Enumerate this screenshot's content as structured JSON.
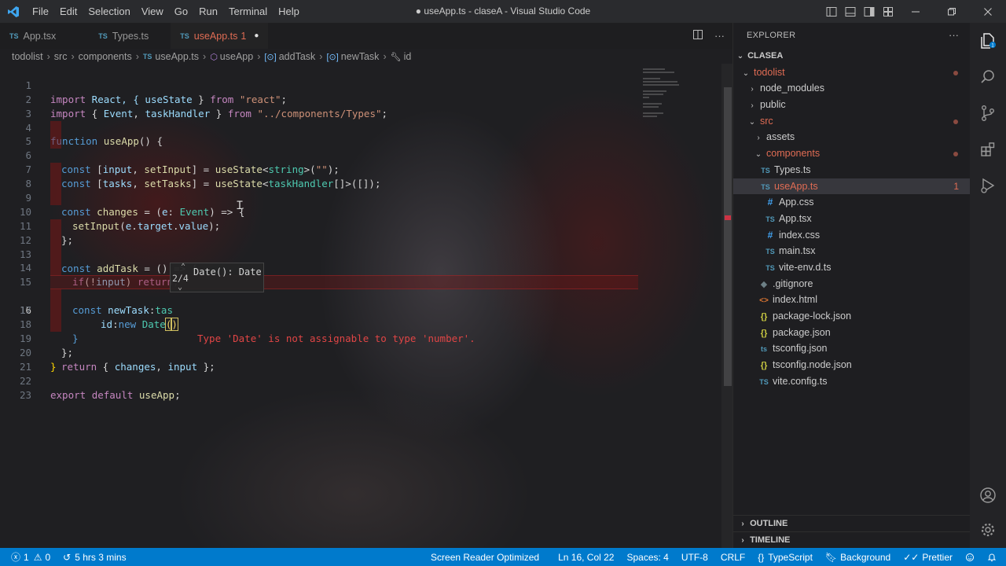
{
  "window": {
    "title": "● useApp.ts - claseA - Visual Studio Code",
    "menu": [
      "File",
      "Edit",
      "Selection",
      "View",
      "Go",
      "Run",
      "Terminal",
      "Help"
    ]
  },
  "tabs": [
    {
      "badge": "TS",
      "label": "App.tsx",
      "active": false
    },
    {
      "badge": "TS",
      "label": "Types.ts",
      "active": false
    },
    {
      "badge": "TS",
      "label": "useApp.ts",
      "problems": "1",
      "active": true
    }
  ],
  "breadcrumb": {
    "b0": "todolist",
    "b1": "src",
    "b2": "components",
    "b3": "useApp.ts",
    "b4": "useApp",
    "b5": "addTask",
    "b6": "newTask",
    "b7": "id",
    "ts_badge": "TS"
  },
  "code": {
    "line_numbers": [
      "1",
      "2",
      "3",
      "4",
      "5",
      "6",
      "7",
      "8",
      "9",
      "10",
      "11",
      "12",
      "13",
      "14",
      "15",
      "16",
      "17",
      "18",
      "19",
      "20",
      "21",
      "22",
      "23"
    ],
    "current_line": "16",
    "l1": {
      "a": "import",
      "b": " React, { ",
      "c": "useState",
      "d": " } ",
      "e": "from",
      "f": " ",
      "g": "\"react\"",
      "h": ";"
    },
    "l2": {
      "a": "import",
      "b": " { ",
      "c": "Event",
      "d": ", ",
      "e": "taskHandler",
      "f": " } ",
      "g": "from",
      "h": " ",
      "i": "\"../components/Types\"",
      "j": ";"
    },
    "l4": {
      "a": "function",
      "b": " ",
      "c": "useApp",
      "d": "() {"
    },
    "l5": {
      "a": "const",
      "b": " [",
      "c": "input",
      "d": ", ",
      "e": "setInput",
      "f": "] = ",
      "g": "useState",
      "h": "<",
      "i": "string",
      "j": ">(",
      "k": "\"\"",
      "l": ");"
    },
    "l6": {
      "a": "const",
      "b": " [",
      "c": "tasks",
      "d": ", ",
      "e": "setTasks",
      "f": "] = ",
      "g": "useState",
      "h": "<",
      "i": "taskHandler",
      "j": "[]>([]);"
    },
    "l8": {
      "a": "const",
      "b": " ",
      "c": "changes",
      "d": " = (",
      "e": "e",
      "f": ": ",
      "g": "Event",
      "h": ") => {"
    },
    "l9": {
      "a": "setInput",
      "b": "(",
      "c": "e",
      "d": ".",
      "e": "target",
      "f": ".",
      "g": "value",
      "h": ");"
    },
    "l10": {
      "a": "};"
    },
    "l12": {
      "a": "const",
      "b": " ",
      "c": "addTask",
      "d": " = () => {"
    },
    "l13": {
      "a": "if",
      "b": "(!",
      "c": "input",
      "d": ") ",
      "e": "return",
      "f": ";"
    },
    "l15": {
      "a": "const",
      "b": " ",
      "c": "newTask",
      "d": ":",
      "e": "tas"
    },
    "l16": {
      "a": "id",
      "b": ":",
      "c": "new",
      "d": " ",
      "e": "Date",
      "f": "(",
      "g": ")"
    },
    "l17": {
      "a": "}"
    },
    "l18": {
      "a": "};"
    },
    "l19": {
      "a": "return",
      "b": " { ",
      "c": "changes",
      "d": ", ",
      "e": "input",
      "f": " };"
    },
    "l20": {
      "a": "}"
    },
    "l22": {
      "a": "export",
      "b": " ",
      "c": "default",
      "d": " ",
      "e": "useApp",
      "f": ";"
    },
    "error_message": "Type 'Date' is not assignable to type 'number'."
  },
  "hover": {
    "counter": "2/4",
    "signature": "Date(): Date"
  },
  "explorer": {
    "header": "EXPLORER",
    "workspace": "CLASEA",
    "items": [
      {
        "label": "todolist",
        "depth": 1,
        "type": "folder-open",
        "red": true,
        "dot": true
      },
      {
        "label": "node_modules",
        "depth": 2,
        "type": "folder"
      },
      {
        "label": "public",
        "depth": 2,
        "type": "folder"
      },
      {
        "label": "src",
        "depth": 2,
        "type": "folder-open",
        "red": true,
        "dot": true
      },
      {
        "label": "assets",
        "depth": 3,
        "type": "folder"
      },
      {
        "label": "components",
        "depth": 3,
        "type": "folder-open",
        "red": true,
        "dot": true
      },
      {
        "label": "Types.ts",
        "depth": 4,
        "type": "ts"
      },
      {
        "label": "useApp.ts",
        "depth": 4,
        "type": "ts",
        "red": true,
        "selected": true,
        "count": "1"
      },
      {
        "label": "App.css",
        "depth": 3,
        "type": "css"
      },
      {
        "label": "App.tsx",
        "depth": 3,
        "type": "ts"
      },
      {
        "label": "index.css",
        "depth": 3,
        "type": "css"
      },
      {
        "label": "main.tsx",
        "depth": 3,
        "type": "ts"
      },
      {
        "label": "vite-env.d.ts",
        "depth": 3,
        "type": "ts"
      },
      {
        "label": ".gitignore",
        "depth": 2,
        "type": "git"
      },
      {
        "label": "index.html",
        "depth": 2,
        "type": "html"
      },
      {
        "label": "package-lock.json",
        "depth": 2,
        "type": "json"
      },
      {
        "label": "package.json",
        "depth": 2,
        "type": "json"
      },
      {
        "label": "tsconfig.json",
        "depth": 2,
        "type": "tsconfig"
      },
      {
        "label": "tsconfig.node.json",
        "depth": 2,
        "type": "json"
      },
      {
        "label": "vite.config.ts",
        "depth": 2,
        "type": "ts"
      }
    ],
    "outline": "OUTLINE",
    "timeline": "TIMELINE"
  },
  "status": {
    "errors": "1",
    "warnings": "0",
    "time": "5 hrs 3 mins",
    "screen_reader": "Screen Reader Optimized",
    "position": "Ln 16, Col 22",
    "spaces": "Spaces: 4",
    "encoding": "UTF-8",
    "eol": "CRLF",
    "language": "TypeScript",
    "background": "Background",
    "prettier": "Prettier"
  },
  "colors": {
    "status_bar": "#007acc",
    "error": "#e04545",
    "modified_tab": "#e06c54"
  }
}
